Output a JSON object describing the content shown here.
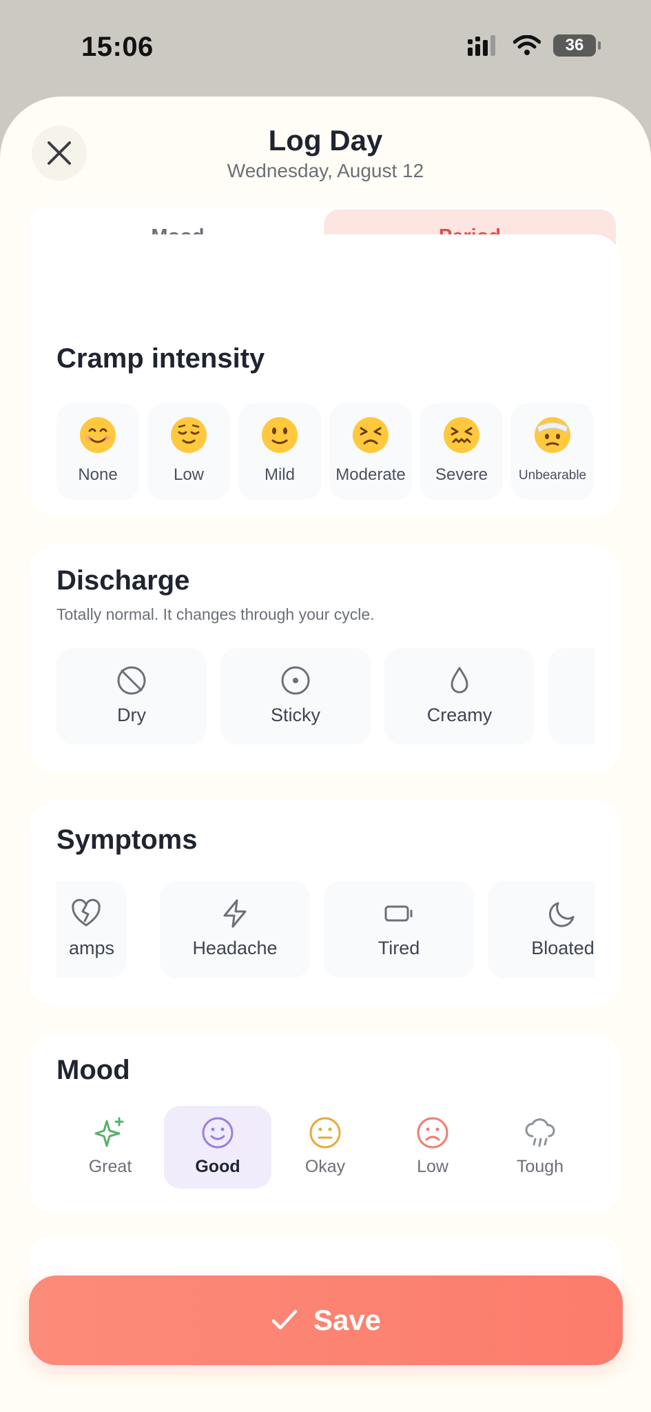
{
  "status": {
    "time": "15:06",
    "battery": "36"
  },
  "header": {
    "title": "Log Day",
    "subtitle": "Wednesday, August 12"
  },
  "tabs": [
    {
      "label": "Mood"
    },
    {
      "label": "Period"
    }
  ],
  "cramp": {
    "title": "Cramp intensity",
    "options": [
      {
        "label": "None"
      },
      {
        "label": "Low"
      },
      {
        "label": "Mild"
      },
      {
        "label": "Moderate"
      },
      {
        "label": "Severe"
      },
      {
        "label": "Unbearable"
      }
    ]
  },
  "discharge": {
    "title": "Discharge",
    "subtitle": "Totally normal. It changes through your cycle.",
    "options": [
      {
        "label": "Dry"
      },
      {
        "label": "Sticky"
      },
      {
        "label": "Creamy"
      }
    ]
  },
  "symptoms": {
    "title": "Symptoms",
    "options": [
      {
        "label": "amps"
      },
      {
        "label": "Headache"
      },
      {
        "label": "Tired"
      },
      {
        "label": "Bloated"
      }
    ]
  },
  "mood": {
    "title": "Mood",
    "options": [
      {
        "label": "Great",
        "color": "#58b06a"
      },
      {
        "label": "Good",
        "color": "#9b7fe0"
      },
      {
        "label": "Okay",
        "color": "#e9a93a"
      },
      {
        "label": "Low",
        "color": "#ef7c72"
      },
      {
        "label": "Tough",
        "color": "#8b929c"
      }
    ]
  },
  "save": {
    "label": "Save"
  }
}
